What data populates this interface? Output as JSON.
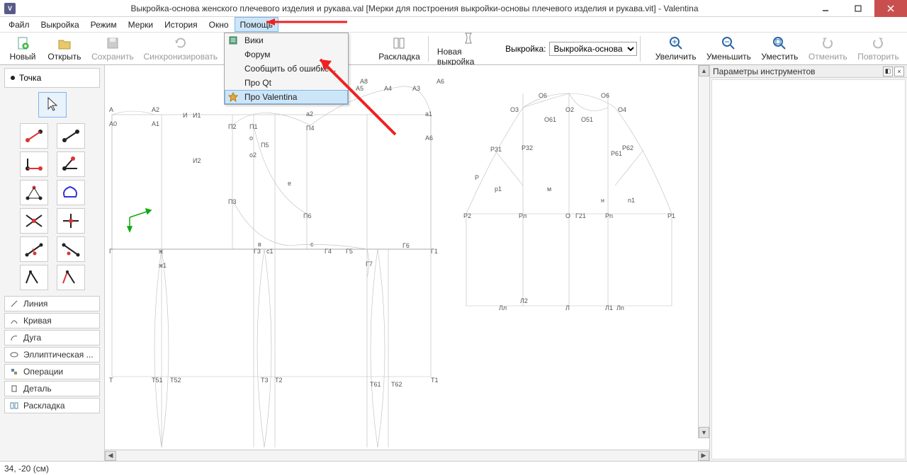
{
  "title": "Выкройка-основа женского плечевого изделия и рукава.val [Мерки для построения выкройки-основы плечевого изделия и рукава.vit] - Valentina",
  "menu": {
    "items": [
      "Файл",
      "Выкройка",
      "Режим",
      "Мерки",
      "История",
      "Окно",
      "Помощь"
    ],
    "open_index": 6,
    "dropdown": [
      {
        "label": "Вики",
        "icon": "book"
      },
      {
        "label": "Форум",
        "icon": ""
      },
      {
        "label": "Сообщить об ошибке...",
        "icon": ""
      },
      {
        "label": "Про Qt",
        "icon": ""
      },
      {
        "label": "Про Valentina",
        "icon": "star",
        "hover": true
      }
    ]
  },
  "toolbar": {
    "new": "Новый",
    "open": "Открыть",
    "save": "Сохранить",
    "sync": "Синхронизировать",
    "layout": "Раскладка",
    "newpattern": "Новая выкройка",
    "pattern_label": "Выкройка:",
    "pattern_value": "Выкройка-основа",
    "zoomin": "Увеличить",
    "zoomout": "Уменьшить",
    "fit": "Уместить",
    "undo": "Отменить",
    "redo": "Повторить"
  },
  "left": {
    "mode": "Точка",
    "draws": [
      {
        "label": "Линия",
        "icon": "line"
      },
      {
        "label": "Кривая",
        "icon": "curve"
      },
      {
        "label": "Дуга",
        "icon": "arc"
      },
      {
        "label": "Эллиптическая ...",
        "icon": "ellipse"
      },
      {
        "label": "Операции",
        "icon": "ops"
      },
      {
        "label": "Деталь",
        "icon": "detail"
      },
      {
        "label": "Раскладка",
        "icon": "layout"
      }
    ]
  },
  "right": {
    "title": "Параметры инструментов"
  },
  "status": "34, -20 (см)",
  "canvas": {
    "labels_left": [
      "А",
      "А0",
      "А1",
      "А2",
      "И",
      "И1",
      "И2",
      "ж",
      "ж1",
      "Г",
      "Г3",
      "Г4",
      "Г5",
      "Г6",
      "Г1",
      "Г7",
      "Г21",
      "П2",
      "П1",
      "П3",
      "П4",
      "П5",
      "П6",
      "о",
      "о2",
      "е",
      "в",
      "с",
      "с1",
      "a2",
      "a1",
      "А5",
      "А4",
      "А6",
      "А3",
      "А8",
      "Т",
      "Т51",
      "Т52",
      "Т3",
      "Т2",
      "Т61",
      "Т62",
      "Т1"
    ],
    "labels_right": [
      "О3",
      "О6",
      "О61",
      "О2",
      "О4",
      "О51",
      "Р31",
      "Р32",
      "Р61",
      "Р62",
      "Р",
      "р1",
      "м",
      "н",
      "n1",
      "Р2",
      "Рл",
      "О",
      "Рn",
      "Р1",
      "Лл",
      "Л2",
      "Л",
      "Л1",
      "Лn"
    ]
  }
}
